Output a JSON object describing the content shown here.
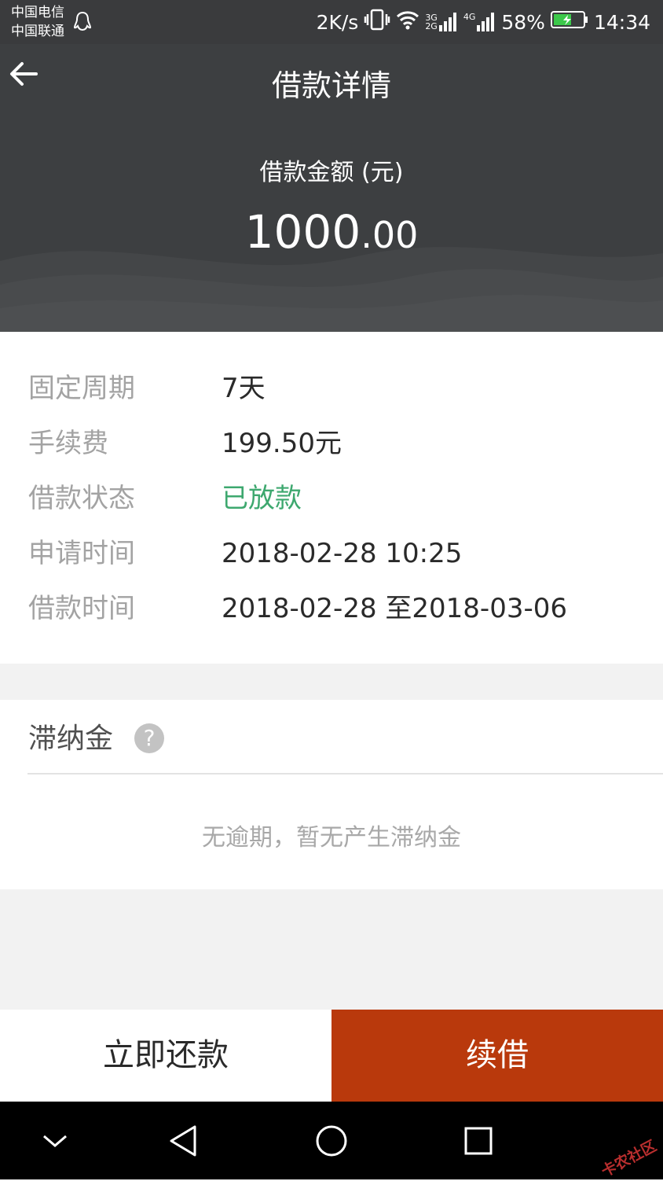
{
  "status_bar": {
    "carrier1": "中国电信",
    "carrier2": "中国联通",
    "speed": "2K/s",
    "net1": "3G",
    "net1b": "2G",
    "net2": "4G",
    "battery": "58%",
    "time": "14:34"
  },
  "header": {
    "title": "借款详情",
    "amount_label": "借款金额 (元)",
    "amount_int": "1000",
    "amount_dec": ".00"
  },
  "details": [
    {
      "label": "固定周期",
      "value": "7天"
    },
    {
      "label": "手续费",
      "value": "199.50元"
    },
    {
      "label": "借款状态",
      "value": "已放款"
    },
    {
      "label": "申请时间",
      "value": "2018-02-28 10:25"
    },
    {
      "label": "借款时间",
      "value": "2018-02-28 至2018-03-06"
    }
  ],
  "late_fee": {
    "title": "滞纳金",
    "help": "?",
    "empty_text": "无逾期，暂无产生滞纳金"
  },
  "actions": {
    "repay": "立即还款",
    "renew": "续借"
  },
  "watermark": "卡农社区",
  "colors": {
    "header_bg": "#3d3f41",
    "status_green": "#3ea86f",
    "renew_bg": "#b9390c"
  }
}
